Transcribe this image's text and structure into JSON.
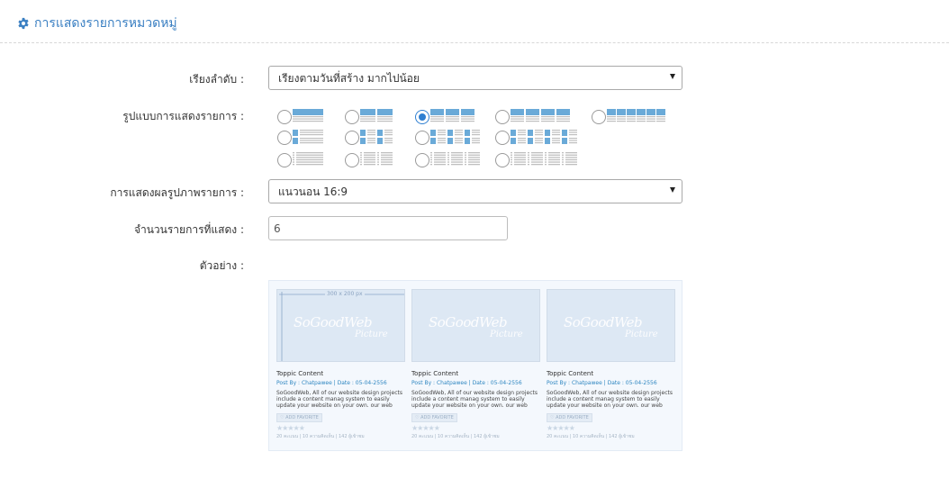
{
  "header": {
    "title": "การแสดงรายการหมวดหมู่",
    "icon": "gear-icon",
    "accent_color": "#3a7fc2"
  },
  "form": {
    "sort": {
      "label": "เรียงลำดับ :",
      "value": "เรียงตามวันที่สร้าง มากไปน้อย"
    },
    "layout": {
      "label": "รูปแบบการแสดงรายการ :",
      "selected_index": 2,
      "option_count": 13
    },
    "image_display": {
      "label": "การแสดงผลรูปภาพรายการ :",
      "value": "แนวนอน 16:9"
    },
    "item_count": {
      "label": "จำนวนรายการที่แสดง :",
      "value": "6"
    },
    "example": {
      "label": "ตัวอย่าง :"
    }
  },
  "preview": {
    "cards": [
      {
        "dimension": "300 x 200 px",
        "logo_main": "SoGoodWeb",
        "logo_sub": "Picture",
        "title": "Toppic Content",
        "meta": "Post By : Chatpawee  |  Date : 05-04-2556",
        "desc": "SoGoodWeb, All of our website design projects include a content manag system to easily update your website on your own. our web designers can",
        "fav": "ADD FAVORITE",
        "stars": "★★★★★",
        "stats": "20 คะแนน | 10 ความคิดเห็น | 142 ผู้เข้าชม"
      },
      {
        "dimension": "",
        "logo_main": "SoGoodWeb",
        "logo_sub": "Picture",
        "title": "Toppic Content",
        "meta": "Post By : Chatpawee  |  Date : 05-04-2556",
        "desc": "SoGoodWeb, All of our website design projects include a content manag system to easily update your website on your own. our web designers can",
        "fav": "ADD FAVORITE",
        "stars": "★★★★★",
        "stats": "20 คะแนน | 10 ความคิดเห็น | 142 ผู้เข้าชม"
      },
      {
        "dimension": "",
        "logo_main": "SoGoodWeb",
        "logo_sub": "Picture",
        "title": "Toppic Content",
        "meta": "Post By : Chatpawee  |  Date : 05-04-2556",
        "desc": "SoGoodWeb, All of our website design projects include a content manag system to easily update your website on your own. our web designers can",
        "fav": "ADD FAVORITE",
        "stars": "★★★★★",
        "stats": "20 คะแนน | 10 ความคิดเห็น | 142 ผู้เข้าชม"
      }
    ]
  }
}
